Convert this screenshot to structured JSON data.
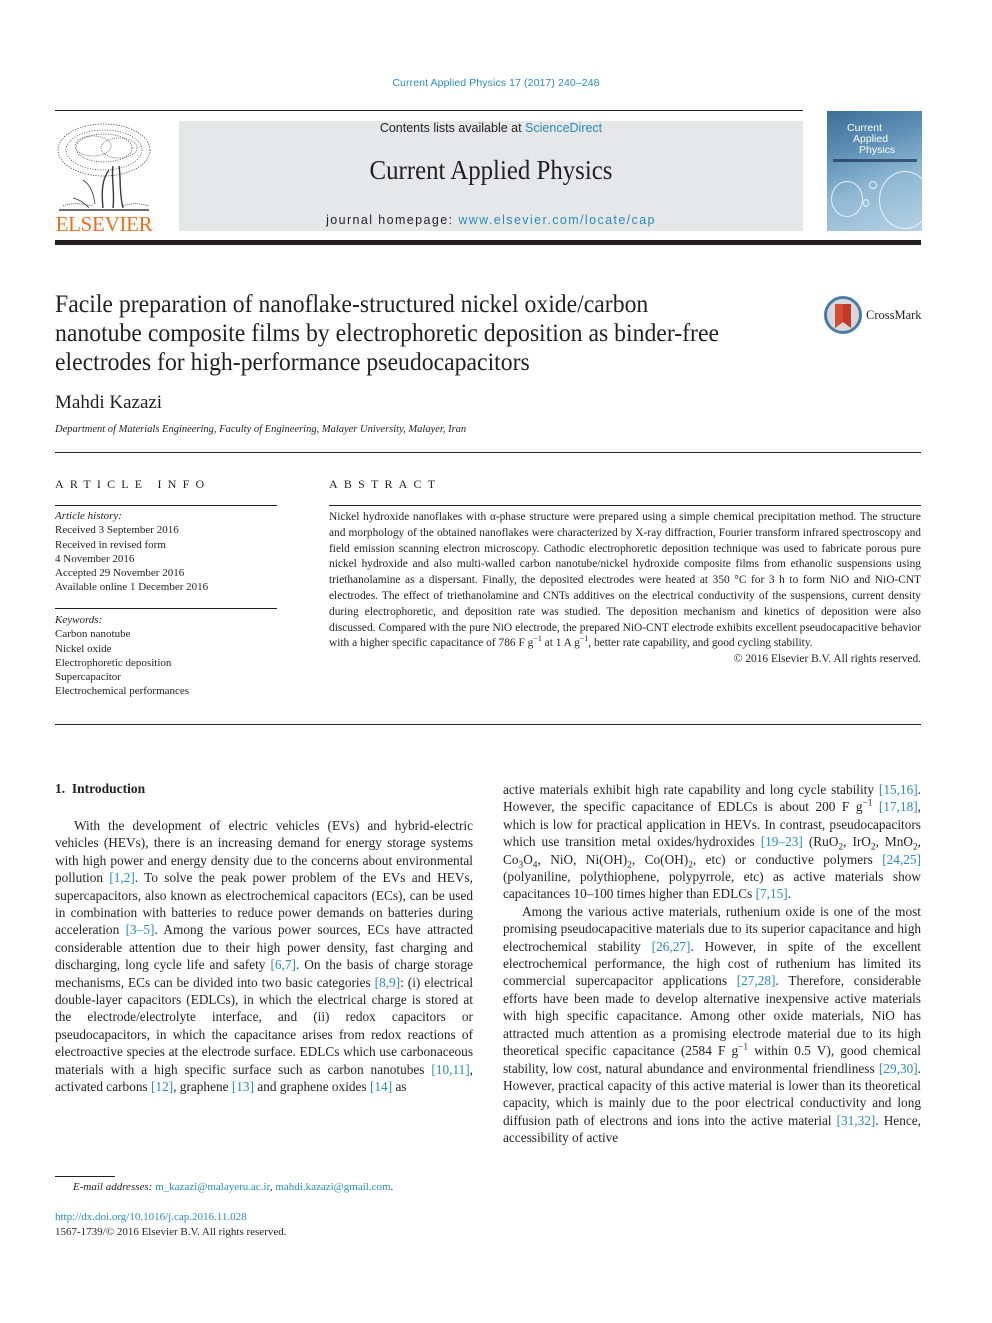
{
  "header": {
    "citation": "Current Applied Physics 17 (2017) 240–248",
    "contents_prefix": "Contents lists available at ",
    "contents_link": "ScienceDirect",
    "journal_title": "Current Applied Physics",
    "homepage_prefix": "journal homepage: ",
    "homepage_link": "www.elsevier.com/locate/cap",
    "publisher_logo_text": "ELSEVIER",
    "cover": {
      "line1": "Current",
      "line2": "Applied",
      "line3": "Physics"
    }
  },
  "article": {
    "title": [
      "Facile preparation of nanoflake-structured nickel oxide/carbon",
      "nanotube composite films by electrophoretic deposition as binder-free",
      "electrodes for high-performance pseudocapacitors"
    ],
    "crossmark_label": "CrossMark",
    "author": "Mahdi Kazazi",
    "affiliation": "Department of Materials Engineering, Faculty of Engineering, Malayer University, Malayer, Iran"
  },
  "article_info": {
    "heading": "ARTICLE INFO",
    "history_label": "Article history:",
    "history": [
      "Received 3 September 2016",
      "Received in revised form",
      "4 November 2016",
      "Accepted 29 November 2016",
      "Available online 1 December 2016"
    ],
    "keywords_label": "Keywords:",
    "keywords": [
      "Carbon nanotube",
      "Nickel oxide",
      "Electrophoretic deposition",
      "Supercapacitor",
      "Electrochemical performances"
    ]
  },
  "abstract": {
    "heading": "ABSTRACT",
    "text_part1": "Nickel hydroxide nanoflakes with α-phase structure were prepared using a simple chemical precipitation method. The structure and morphology of the obtained nanoflakes were characterized by X-ray diffraction, Fourier transform infrared spectroscopy and field emission scanning electron microscopy. Cathodic electrophoretic deposition technique was used to fabricate porous pure nickel hydroxide and also multi-walled carbon nanotube/nickel hydroxide composite films from ethanolic suspensions using triethanolamine as a dispersant. Finally, the deposited electrodes were heated at 350 °C for 3 h to form NiO and NiO-CNT electrodes. The effect of triethanolamine and CNTs additives on the electrical conductivity of the suspensions, current density during electrophoretic, and deposition rate was studied. The deposition mechanism and kinetics of deposition were also discussed. Compared with the pure NiO electrode, the prepared NiO-CNT electrode exhibits excellent pseudocapacitive behavior with a higher specific capacitance of 786 F g",
    "sup1": "−1",
    "text_part2": " at 1 A g",
    "sup2": "−1",
    "text_part3": ", better rate capability, and good cycling stability.",
    "copyright": "© 2016 Elsevier B.V. All rights reserved."
  },
  "introduction": {
    "heading": "1.  Introduction",
    "left": {
      "t1": "With the development of electric vehicles (EVs) and hybrid-electric vehicles (HEVs), there is an increasing demand for energy storage systems with high power and energy density due to the concerns about environmental pollution ",
      "r1": "[1,2]",
      "t2": ". To solve the peak power problem of the EVs and HEVs, supercapacitors, also known as electrochemical capacitors (ECs), can be used in combination with batteries to reduce power demands on batteries during acceleration ",
      "r2": "[3–5]",
      "t3": ". Among the various power sources, ECs have attracted considerable attention due to their high power density, fast charging and discharging, long cycle life and safety ",
      "r3": "[6,7]",
      "t4": ". On the basis of charge storage mechanisms, ECs can be divided into two basic categories ",
      "r4": "[8,9]",
      "t5": ": (i) electrical double-layer capacitors (EDLCs), in which the electrical charge is stored at the electrode/electrolyte interface, and (ii) redox capacitors or pseudocapacitors, in which the capacitance arises from redox reactions of electroactive species at the electrode surface. EDLCs which use carbonaceous materials with a high specific surface such as carbon nanotubes ",
      "r5": "[10,11]",
      "t6": ", activated carbons ",
      "r6": "[12]",
      "t7": ", graphene ",
      "r7": "[13]",
      "t8": " and graphene oxides ",
      "r8": "[14]",
      "t9": " as"
    },
    "right_p1": {
      "t1": "active materials exhibit high rate capability and long cycle stability ",
      "r1": "[15,16]",
      "t2": ". However, the specific capacitance of EDLCs is about 200 F g",
      "sup1": "−1",
      "t3": " ",
      "r2": "[17,18]",
      "t4": ", which is low for practical application in HEVs. In contrast, pseudocapacitors which use transition metal oxides/hydroxides ",
      "r3": "[19–23]",
      "t5": " (RuO",
      "t6": ", IrO",
      "t7": ", MnO",
      "t8": ", Co",
      "t9": "O",
      "t10": ", NiO, Ni(OH)",
      "t11": ", Co(OH)",
      "t12": ", etc) or conductive polymers ",
      "r4": "[24,25]",
      "t13": " (polyaniline, polythiophene, polypyrrole, etc) as active materials show capacitances 10–100 times higher than EDLCs ",
      "r5": "[7,15]",
      "t14": "."
    },
    "right_p2": {
      "t1": "Among the various active materials, ruthenium oxide is one of the most promising pseudocapacitive materials due to its superior capacitance and high electrochemical stability ",
      "r1": "[26,27]",
      "t2": ". However, in spite of the excellent electrochemical performance, the high cost of ruthenium has limited its commercial supercapacitor applications ",
      "r2": "[27,28]",
      "t3": ". Therefore, considerable efforts have been made to develop alternative inexpensive active materials with high specific capacitance. Among other oxide materials, NiO has attracted much attention as a promising electrode material due to its high theoretical specific capacitance (2584 F g",
      "sup1": "−1",
      "t4": " within 0.5 V), good chemical stability, low cost, natural abundance and environmental friendliness ",
      "r3": "[29,30]",
      "t5": ". However, practical capacity of this active material is lower than its theoretical capacity, which is mainly due to the poor electrical conductivity and long diffusion path of electrons and ions into the active material ",
      "r4": "[31,32]",
      "t6": ". Hence, accessibility of active"
    }
  },
  "footer": {
    "email_label": "E-mail addresses: ",
    "email1": "m_kazazi@malayeru.ac.ir",
    "sep": ", ",
    "email2": "mahdi.kazazi@gmail.com",
    "end": ".",
    "doi": "http://dx.doi.org/10.1016/j.cap.2016.11.028",
    "issn": "1567-1739/© 2016 Elsevier B.V. All rights reserved."
  },
  "colors": {
    "link": "#2a8bb8",
    "publisher_orange": "#e9711c",
    "banner_bg": "#e6e7e8"
  }
}
